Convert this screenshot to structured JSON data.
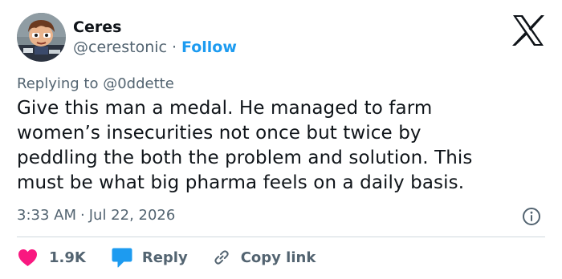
{
  "user": {
    "display_name": "Ceres",
    "handle": "@cerestonic",
    "separator": "·",
    "follow_label": "Follow",
    "avatar_icon": "cartoon-character-avatar"
  },
  "header": {
    "logo_icon": "x-logo-icon"
  },
  "reply_context": {
    "prefix": "Replying to",
    "mention": "@0ddette"
  },
  "tweet": {
    "lines": [
      "Give this man a medal. He managed to farm",
      "women’s insecurities not once but twice by",
      "peddling the both the problem and solution. This",
      "must be what big pharma feels on a daily basis."
    ]
  },
  "meta": {
    "time": "3:33 AM",
    "separator": "·",
    "date": "Jul 22, 2026",
    "info_icon": "info-icon"
  },
  "actions": {
    "like_count": "1.9K",
    "reply_label": "Reply",
    "copy_link_label": "Copy link"
  },
  "colors": {
    "like_red": "#f91880",
    "reply_blue": "#1d9bf0",
    "link_blue": "#1d9bf0",
    "secondary_text": "#536471",
    "divider": "#cfd9de"
  }
}
